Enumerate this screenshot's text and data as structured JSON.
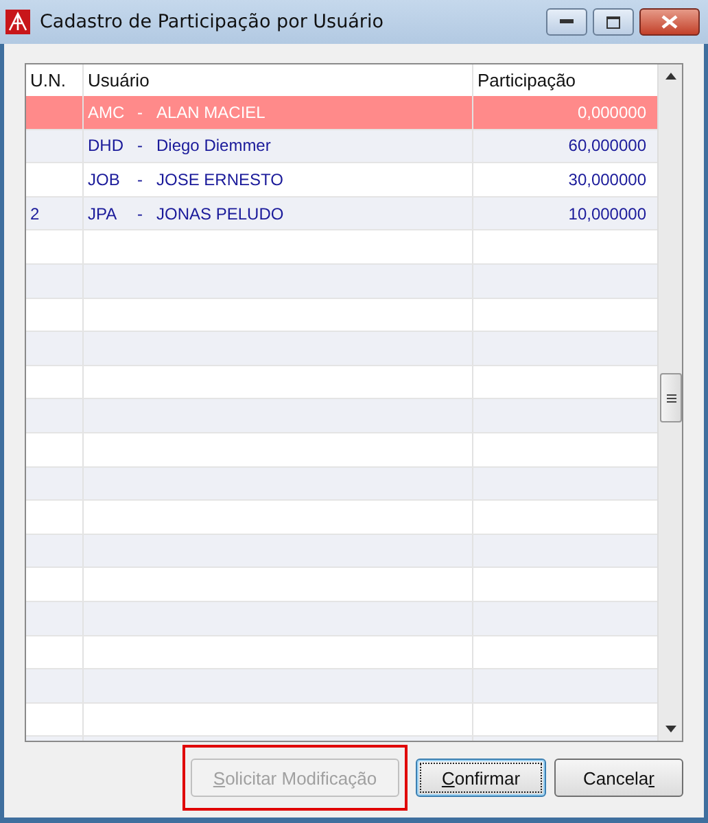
{
  "window": {
    "title": "Cadastro de Participação por Usuário"
  },
  "table": {
    "columns": [
      "U.N.",
      "Usuário",
      "Participação"
    ],
    "rows": [
      {
        "un": null,
        "code": "AMC",
        "separator": "-",
        "name": "ALAN MACIEL",
        "participation": "0,000000",
        "selected": true
      },
      {
        "un": null,
        "code": "DHD",
        "separator": "-",
        "name": "Diego Diemmer",
        "participation": "60,000000",
        "selected": false
      },
      {
        "un": null,
        "code": "JOB",
        "separator": "-",
        "name": "JOSE ERNESTO",
        "participation": "30,000000",
        "selected": false
      },
      {
        "un": "2",
        "code": "JPA",
        "separator": "-",
        "name": "JONAS PELUDO",
        "participation": "10,000000",
        "selected": false
      }
    ]
  },
  "buttons": [
    {
      "key": "S",
      "after": "olicitar Modificação",
      "disabled": true,
      "focused": false,
      "highlighted": true
    },
    {
      "key": "C",
      "after": "onfirmar",
      "disabled": false,
      "focused": true,
      "highlighted": false
    },
    {
      "before": "Cancela",
      "key": "r",
      "disabled": false,
      "focused": false,
      "highlighted": false
    }
  ]
}
